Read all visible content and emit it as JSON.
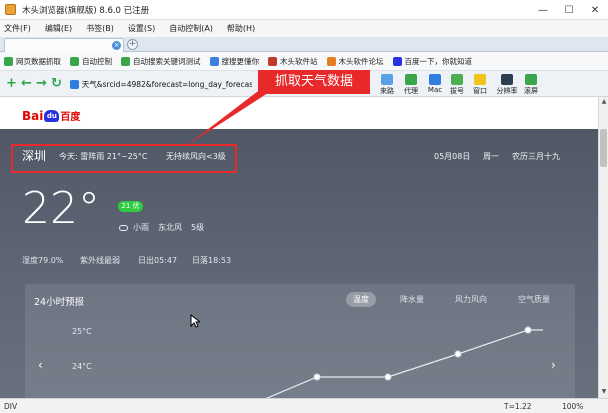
{
  "window": {
    "title": "木头浏览器(旗舰版) 8.6.0 已注册"
  },
  "menu": [
    "文件(F)",
    "编辑(E)",
    "书签(B)",
    "设置(S)",
    "自动控制(A)",
    "帮助(H)"
  ],
  "favorites": [
    "网页数据抓取",
    "自动控制",
    "自动搜索关键词测试",
    "搜搜更懂你",
    "木头软件站",
    "木头软件论坛",
    "百度一下，你就知道"
  ],
  "address": {
    "value": "天气&srcid=4982&forecast=long_day_forecast"
  },
  "tools": [
    "来路",
    "代理",
    "Mac",
    "拔号",
    "窗口",
    "分辨率",
    "滚屏"
  ],
  "annotation": {
    "label": "抓取天气数据"
  },
  "page": {
    "logo": {
      "bai": "Bai",
      "du": "du",
      "baidu": "百度"
    },
    "city": "深圳",
    "today": "今天: 雷阵雨 21°~25°C",
    "wind": "无持续风向<3级",
    "date": "05月08日",
    "weekday": "周一",
    "lunar": "农历三月十九",
    "temp": "22°",
    "aqi": "21 优",
    "condition": "小雨",
    "wind_dir": "东北风",
    "wind_level": "5级",
    "humidity": "湿度79.0%",
    "uv": "紫外线最弱",
    "sunrise": "日出05:47",
    "sunset": "日落18:53",
    "forecast": {
      "title": "24小时预报",
      "tabs": [
        "温度",
        "降水量",
        "风力风向",
        "空气质量"
      ],
      "y_labels": [
        "25°C",
        "24°C"
      ],
      "prev_icon": "‹",
      "next_icon": "›"
    }
  },
  "status": {
    "left": "DIV",
    "zoom": "T=1.22",
    "zoom_value": "100%"
  }
}
